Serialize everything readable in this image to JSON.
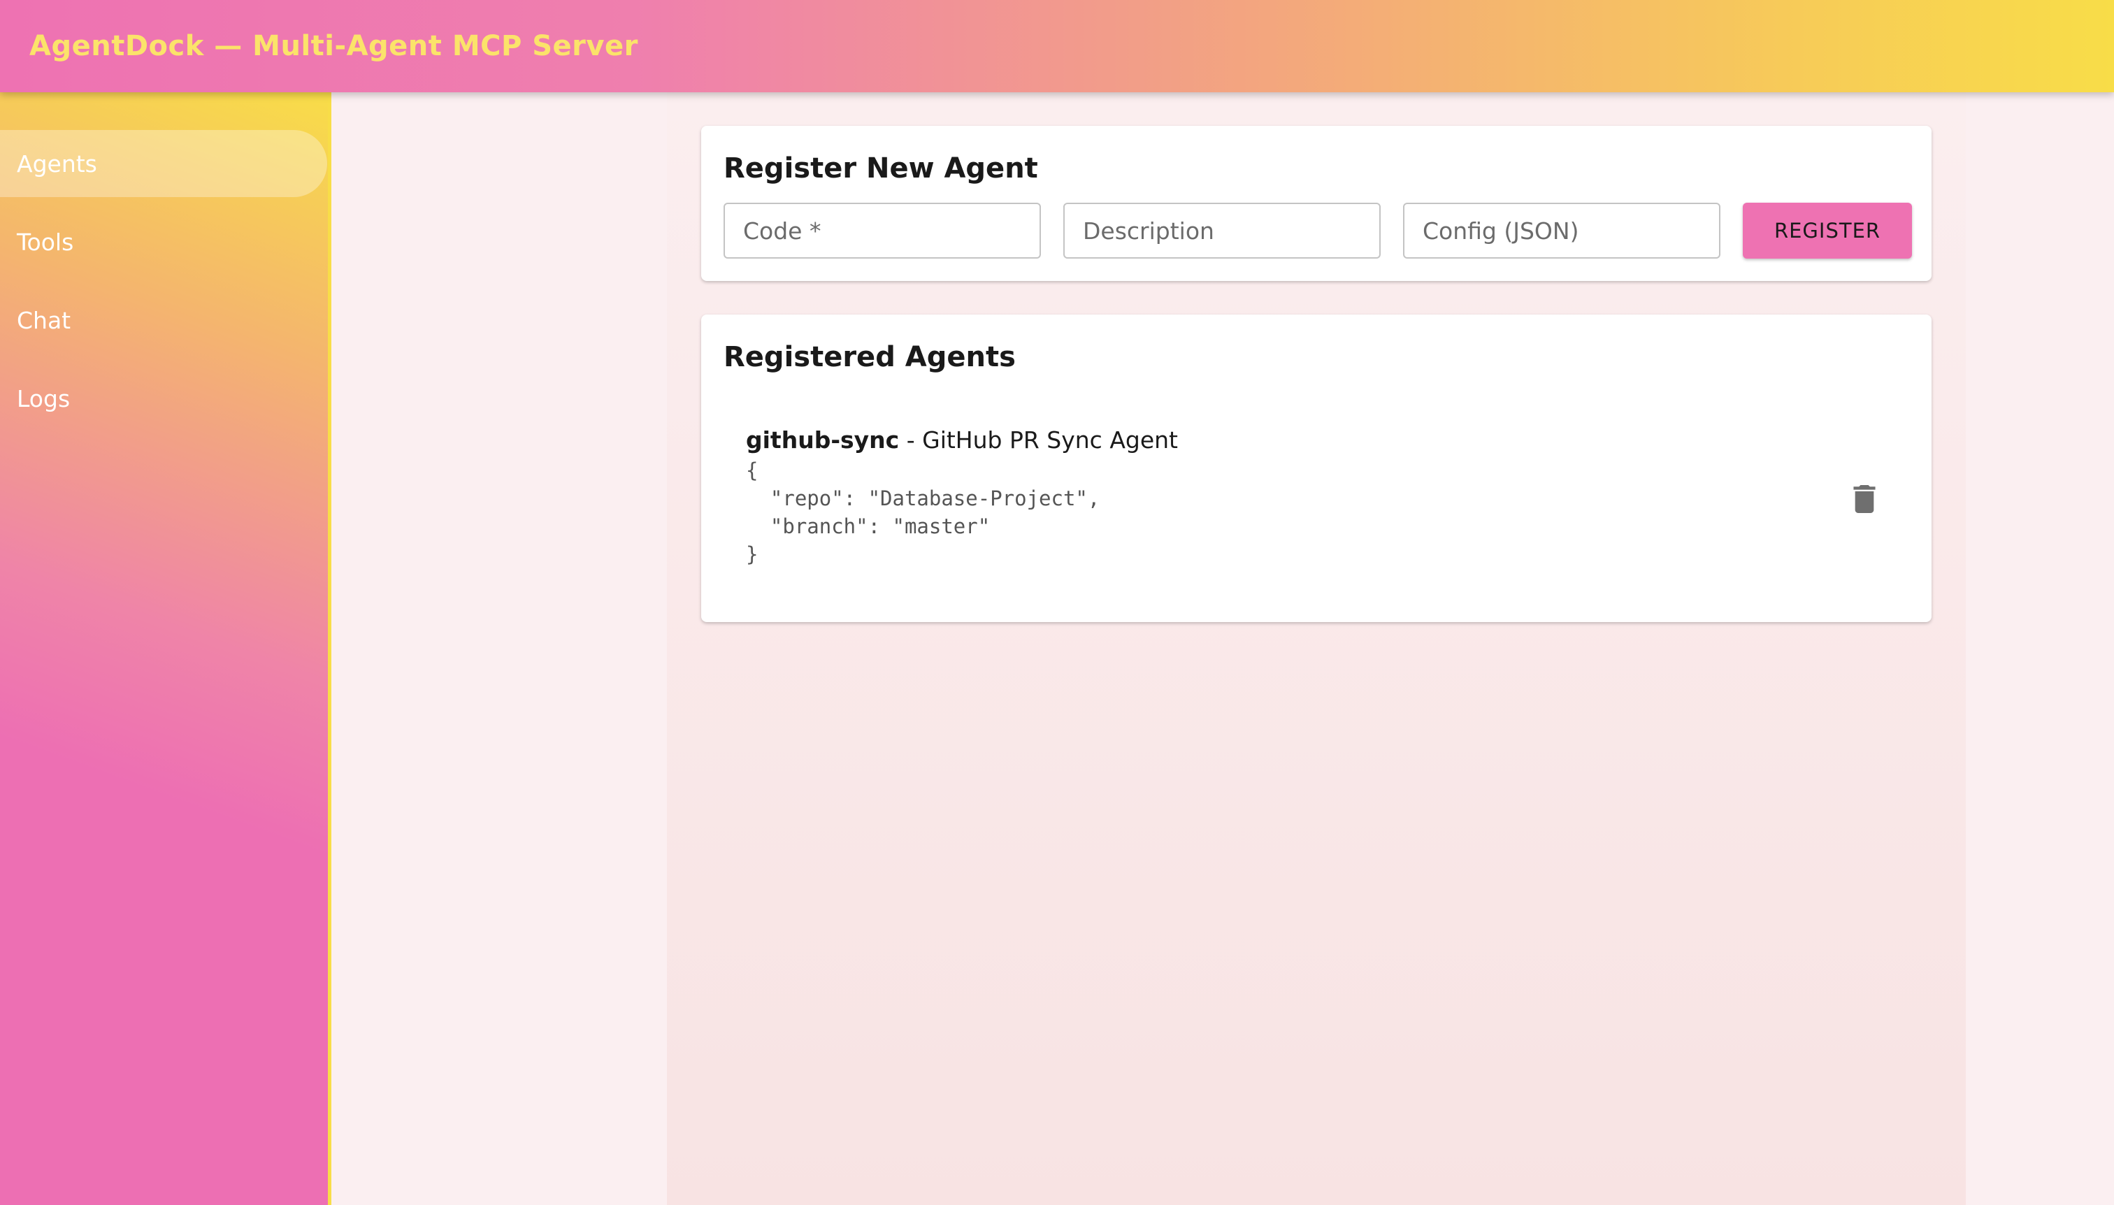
{
  "app": {
    "title": "AgentDock — Multi-Agent MCP Server"
  },
  "sidebar": {
    "items": [
      {
        "label": "Agents",
        "active": true
      },
      {
        "label": "Tools",
        "active": false
      },
      {
        "label": "Chat",
        "active": false
      },
      {
        "label": "Logs",
        "active": false
      }
    ]
  },
  "register": {
    "title": "Register New Agent",
    "code_placeholder": "Code *",
    "description_placeholder": "Description",
    "config_placeholder": "Config (JSON)",
    "button_label": "REGISTER"
  },
  "agents": {
    "title": "Registered Agents",
    "items": [
      {
        "code": "github-sync",
        "separator": " - ",
        "description": "GitHub PR Sync Agent",
        "config_text": "{\n  \"repo\": \"Database-Project\",\n  \"branch\": \"master\"\n}",
        "delete_icon": "trash-icon"
      }
    ]
  },
  "colors": {
    "accent": "#ee72b2",
    "title_text": "#fbe36a",
    "sidebar_border": "#f8dd48",
    "delete_icon": "#6f6f6f"
  }
}
